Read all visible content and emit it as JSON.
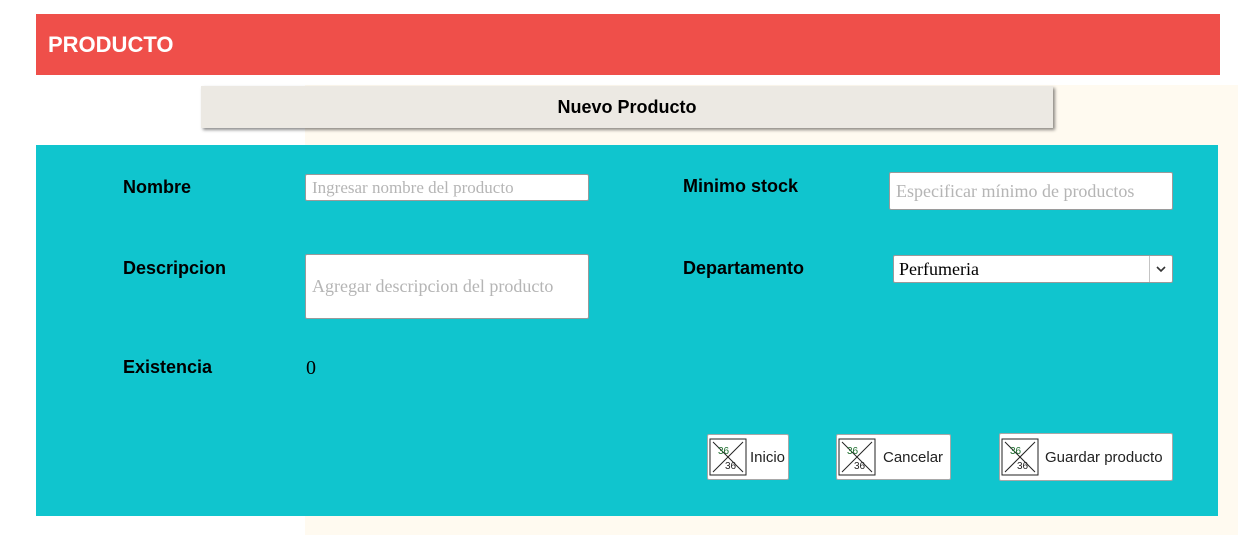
{
  "header": {
    "title": "PRODUCTO"
  },
  "subtitle": {
    "text": "Nuevo Producto"
  },
  "form": {
    "nombre": {
      "label": "Nombre",
      "placeholder": "Ingresar nombre del producto"
    },
    "descripcion": {
      "label": "Descripcion",
      "placeholder": "Agregar descripcion del producto"
    },
    "existencia": {
      "label": "Existencia",
      "value": "0"
    },
    "minimo_stock": {
      "label": "Minimo stock",
      "placeholder": "Especificar mínimo de productos"
    },
    "departamento": {
      "label": "Departamento",
      "selected": "Perfumeria"
    }
  },
  "buttons": {
    "inicio": {
      "label": "Inicio",
      "icon": "broken-image-icon"
    },
    "cancelar": {
      "label": "Cancelar",
      "icon": "broken-image-icon"
    },
    "guardar": {
      "label": "Guardar producto",
      "icon": "broken-image-icon"
    },
    "icon_text": "36"
  },
  "colors": {
    "header": "#ef4f4a",
    "panel": "#10c5ce",
    "subtitle_bar": "#ece9e3",
    "cream": "#fffaf0"
  }
}
